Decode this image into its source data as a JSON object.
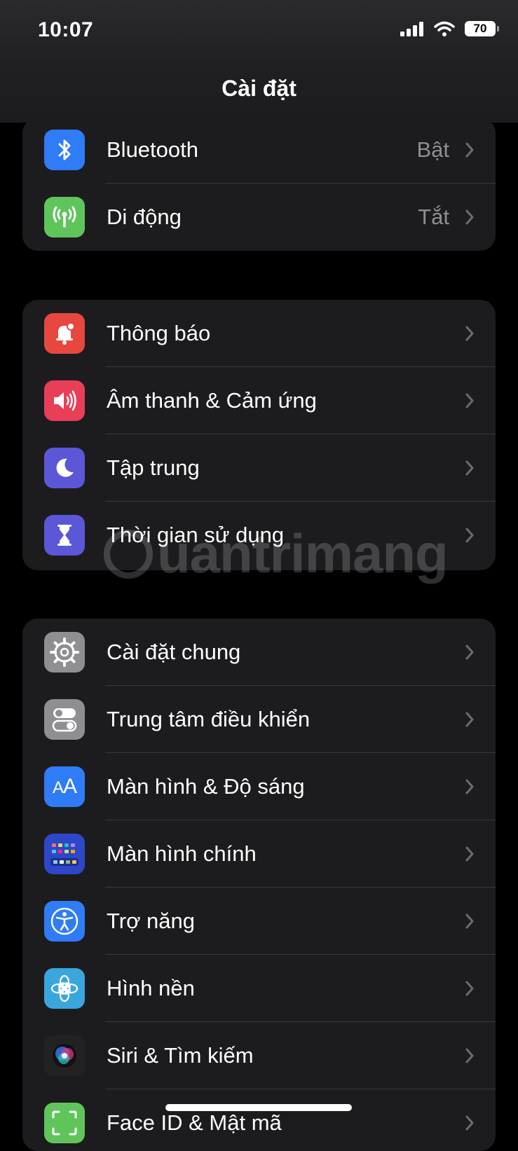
{
  "status": {
    "time": "10:07",
    "battery": "70"
  },
  "nav": {
    "title": "Cài đặt"
  },
  "groups": [
    {
      "rows": [
        {
          "label": "Bluetooth",
          "value": "Bật",
          "icon": "bluetooth-icon",
          "color": "#2f7cf6"
        },
        {
          "label": "Di động",
          "value": "Tắt",
          "icon": "antenna-icon",
          "color": "#5fc55b"
        }
      ]
    },
    {
      "rows": [
        {
          "label": "Thông báo",
          "icon": "bell-icon",
          "color": "#e8473f"
        },
        {
          "label": "Âm thanh & Cảm ứng",
          "icon": "speaker-icon",
          "color": "#e83e57"
        },
        {
          "label": "Tập trung",
          "icon": "moon-icon",
          "color": "#5b57d6"
        },
        {
          "label": "Thời gian sử dụng",
          "icon": "hourglass-icon",
          "color": "#5b57d6"
        }
      ]
    },
    {
      "rows": [
        {
          "label": "Cài đặt chung",
          "icon": "gear-icon",
          "color": "#8e8e93"
        },
        {
          "label": "Trung tâm điều khiển",
          "icon": "toggles-icon",
          "color": "#8e8e93"
        },
        {
          "label": "Màn hình & Độ sáng",
          "icon": "text-size-icon",
          "color": "#2f7cf6"
        },
        {
          "label": "Màn hình chính",
          "icon": "home-grid-icon",
          "color": "#2e47c8"
        },
        {
          "label": "Trợ năng",
          "icon": "accessibility-icon",
          "color": "#2f7cf6"
        },
        {
          "label": "Hình nền",
          "icon": "flower-icon",
          "color": "#3aa6dd"
        },
        {
          "label": "Siri & Tìm kiếm",
          "icon": "siri-icon",
          "color": "#222222"
        },
        {
          "label": "Face ID & Mật mã",
          "icon": "face-id-icon",
          "color": "#5fc55b"
        }
      ]
    }
  ]
}
